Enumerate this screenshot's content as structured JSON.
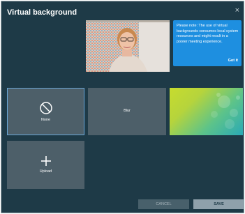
{
  "dialog": {
    "title": "Virtual background",
    "close_glyph": "×"
  },
  "preview": {
    "icon": "user-video-preview"
  },
  "tooltip": {
    "text": "Please note: The use of virtual backgrounds consumes local system resources and might result in a poorer meeting experience.",
    "button_label": "Got it",
    "color": "#1e8fe0"
  },
  "backgrounds": {
    "none_label": "None",
    "blur_label": "Blur",
    "upload_label": "Upload",
    "selected": "None"
  },
  "footer": {
    "cancel_label": "CANCEL",
    "save_label": "SAVE"
  },
  "colors": {
    "dialog_bg": "#1e3a47",
    "tile_bg": "#4d5f69",
    "selected_border": "#6aa8d8"
  }
}
